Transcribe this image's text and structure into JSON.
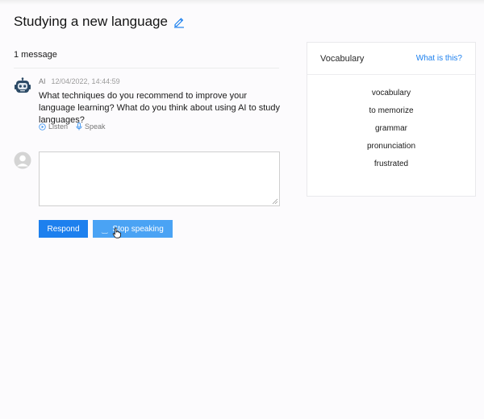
{
  "page": {
    "title": "Studying a new language"
  },
  "conversation": {
    "count_label": "1 message",
    "messages": [
      {
        "author": "AI",
        "timestamp": "12/04/2022, 14:44:59",
        "text": "What techniques do you recommend to improve your language learning? What do you think about using AI to study languages?",
        "actions": {
          "listen": "Listen",
          "speak": "Speak"
        }
      }
    ]
  },
  "reply": {
    "value": "",
    "placeholder": ""
  },
  "buttons": {
    "respond": "Respond",
    "stop": "Stop speaking"
  },
  "vocabulary": {
    "title": "Vocabulary",
    "help_link": "What is this?",
    "items": [
      "vocabulary",
      "to memorize",
      "grammar",
      "pronunciation",
      "frustrated"
    ]
  },
  "icons": {
    "edit": "pencil-icon",
    "ai_avatar": "robot-icon",
    "user_avatar": "user-avatar-icon",
    "listen": "play-circle-icon",
    "speak": "microphone-icon",
    "spinner": "loading-spinner-icon",
    "cursor": "hand-pointer-icon"
  },
  "colors": {
    "accent": "#1d80ee",
    "accent_light": "#4aa3f4",
    "background": "#fcfbfd"
  }
}
